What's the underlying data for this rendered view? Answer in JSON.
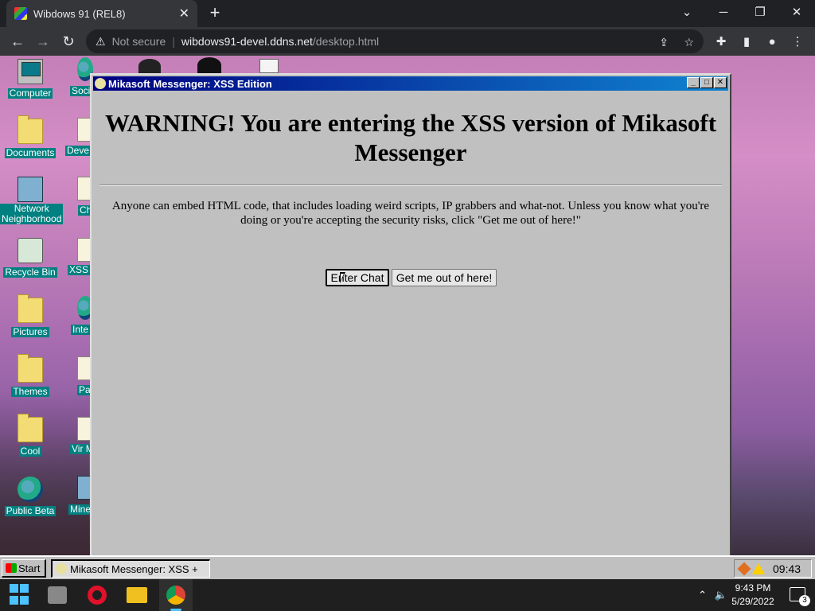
{
  "browser": {
    "tab_title": "Wibdows 91 (REL8)",
    "tab_close": "✕",
    "new_tab": "+",
    "url_warning": "Not secure",
    "url_host": "wibdows91-devel.ddns.net",
    "url_path": "/desktop.html"
  },
  "desktop_icons": [
    {
      "label": "Computer"
    },
    {
      "label": "Documents"
    },
    {
      "label": "Network Neighborhood"
    },
    {
      "label": "Recycle Bin"
    },
    {
      "label": "Pictures"
    },
    {
      "label": "Themes"
    },
    {
      "label": "Cool"
    },
    {
      "label": "Public Beta"
    }
  ],
  "desktop_icons_col2": [
    {
      "label": "Soci"
    },
    {
      "label": "Deve Ins"
    },
    {
      "label": "Ch"
    },
    {
      "label": "XSS"
    },
    {
      "label": "Inte Explo"
    },
    {
      "label": "Pa"
    },
    {
      "label": "Vir Mach"
    },
    {
      "label": "Mine"
    }
  ],
  "window": {
    "title": "Mikasoft Messenger: XSS Edition",
    "heading": "WARNING! You are entering the XSS version of Mikasoft Messenger",
    "body": "Anyone can embed HTML code, that includes loading weird scripts, IP grabbers and what-not. Unless you know what you're doing or you're accepting the security risks, click \"Get me out of here!\"",
    "enter_button": "Enter Chat",
    "exit_button": "Get me out of here!"
  },
  "w95_taskbar": {
    "start_label": "Start",
    "task_label": "Mikasoft Messenger: XSS +",
    "clock": "09:43"
  },
  "os_taskbar": {
    "time": "9:43 PM",
    "date": "5/29/2022",
    "notification_count": "3"
  },
  "colors": {
    "titlebar_start": "#000080",
    "titlebar_end": "#1084d0",
    "icon_label_bg": "#008080",
    "window_bg": "#c0c0c0"
  }
}
